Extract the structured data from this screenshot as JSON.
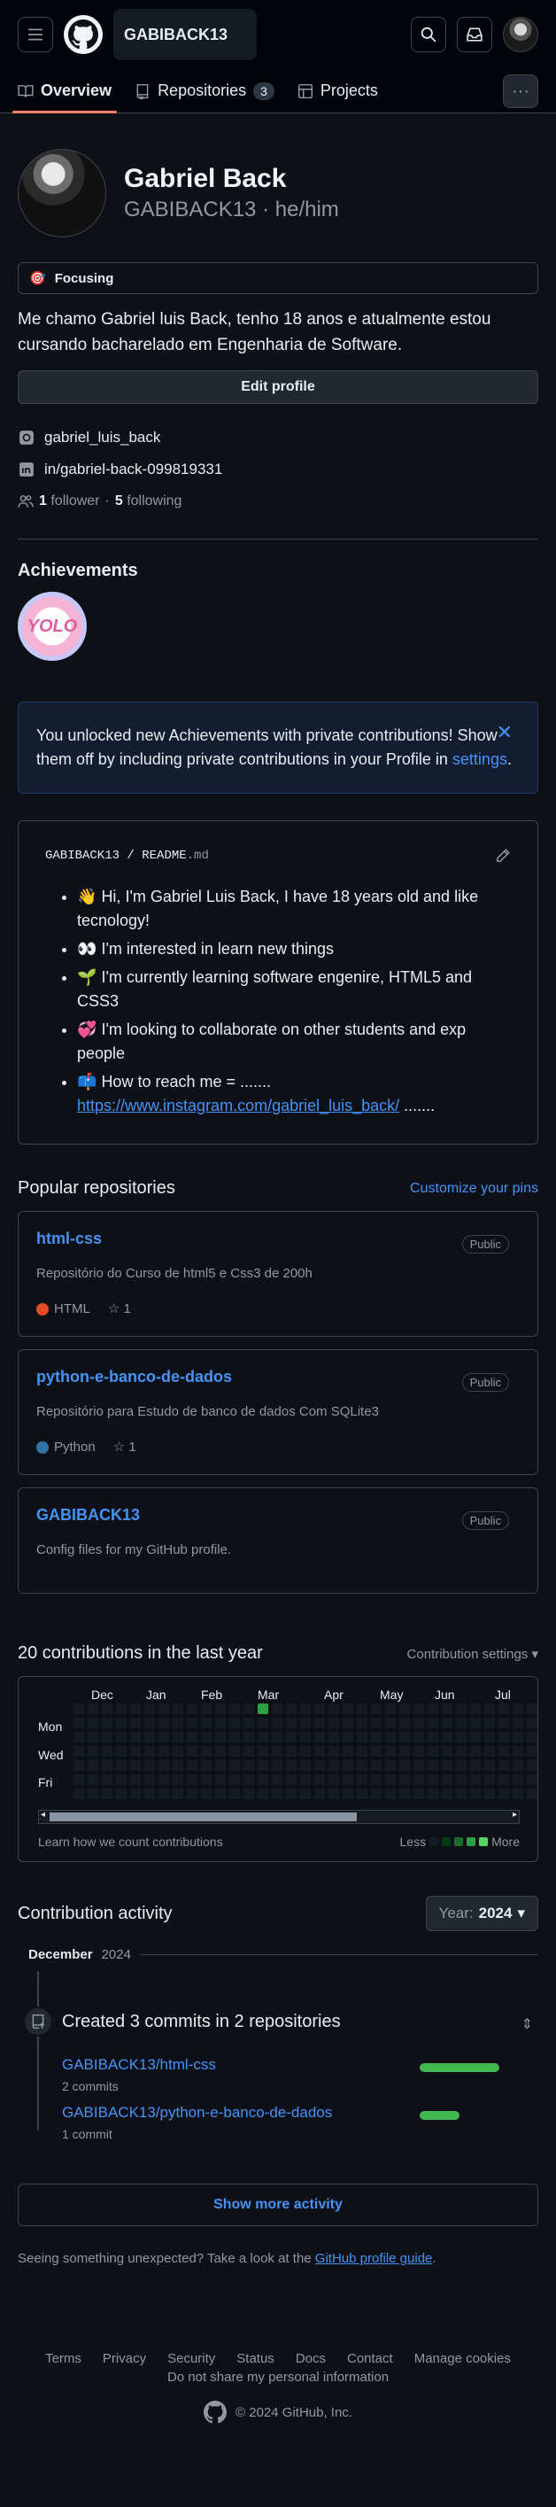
{
  "header": {
    "context_title": "GABIBACK13"
  },
  "tabs": [
    {
      "label": "Overview"
    },
    {
      "label": "Repositories",
      "count": "3"
    },
    {
      "label": "Projects"
    }
  ],
  "profile": {
    "name": "Gabriel Back",
    "login": "GABIBACK13",
    "pronouns": "he/him",
    "status": "Focusing",
    "status_emoji": "🎯",
    "bio": "Me chamo Gabriel luis Back, tenho 18 anos e atualmente estou cursando bacharelado em Engenharia de Software.",
    "edit_label": "Edit profile",
    "instagram": "gabriel_luis_back",
    "linkedin": "in/gabriel-back-099819331",
    "followers_count": "1",
    "followers_label": "follower",
    "following_count": "5",
    "following_label": "following",
    "separator": "·"
  },
  "achievements": {
    "title": "Achievements",
    "badge_text": "YOLO"
  },
  "notice": {
    "text": "You unlocked new Achievements with private contributions! Show them off by including private contributions in your Profile in ",
    "link": "settings",
    "end": "."
  },
  "readme": {
    "path_user": "GABIBACK13",
    "path_sep": " / ",
    "path_file": "README",
    "path_ext": ".md",
    "items": [
      {
        "emoji": "👋",
        "text": "Hi, I'm Gabriel Luis Back, I have 18 years old and like tecnology!"
      },
      {
        "emoji": "👀",
        "text": "I'm interested in learn new things"
      },
      {
        "emoji": "🌱",
        "text": "I'm currently learning software engenire, HTML5 and CSS3"
      },
      {
        "emoji": "💞️",
        "text": "I'm looking to collaborate on other students and exp people"
      },
      {
        "emoji": "📫",
        "text": "How to reach me = .......",
        "link": "https://www.instagram.com/gabriel_luis_back/",
        "after": " ......."
      }
    ]
  },
  "popular": {
    "title": "Popular repositories",
    "customize": "Customize your pins",
    "repos": [
      {
        "name": "html-css",
        "visibility": "Public",
        "desc": "Repositório do Curso de html5 e Css3 de 200h",
        "lang": "HTML",
        "lang_color": "#e34c26",
        "stars": "1"
      },
      {
        "name": "python-e-banco-de-dados",
        "visibility": "Public",
        "desc": "Repositório para Estudo de banco de dados Com SQLite3",
        "lang": "Python",
        "lang_color": "#3572A5",
        "stars": "1"
      },
      {
        "name": "GABIBACK13",
        "visibility": "Public",
        "desc": "Config files for my GitHub profile."
      }
    ]
  },
  "contributions": {
    "title": "20 contributions in the last year",
    "settings": "Contribution settings",
    "months": [
      "Dec",
      "Jan",
      "Feb",
      "Mar",
      "Apr",
      "May",
      "Jun",
      "Jul"
    ],
    "days": [
      "Mon",
      "Wed",
      "Fri"
    ],
    "learn": "Learn how we count contributions",
    "less": "Less",
    "more": "More",
    "empty_color": "#151b23",
    "levels": [
      "#151b23",
      "#033a16",
      "#196c2e",
      "#2ea043",
      "#56d364"
    ]
  },
  "activity": {
    "title": "Contribution activity",
    "year_label": "Year:",
    "year": "2024",
    "month": "December",
    "month_year": "2024",
    "event": "Created 3 commits in 2 repositories",
    "repos": [
      {
        "name": "GABIBACK13/html-css",
        "commits": "2 commits",
        "share": 0.67
      },
      {
        "name": "GABIBACK13/python-e-banco-de-dados",
        "commits": "1 commit",
        "share": 0.33
      }
    ],
    "show_more": "Show more activity"
  },
  "unexpected": {
    "text": "Seeing something unexpected? Take a look at the ",
    "link": "GitHub profile guide",
    "end": "."
  },
  "footer": {
    "links": [
      "Terms",
      "Privacy",
      "Security",
      "Status",
      "Docs",
      "Contact",
      "Manage cookies"
    ],
    "dnsp": "Do not share my personal information",
    "copyright": "© 2024 GitHub, Inc."
  }
}
